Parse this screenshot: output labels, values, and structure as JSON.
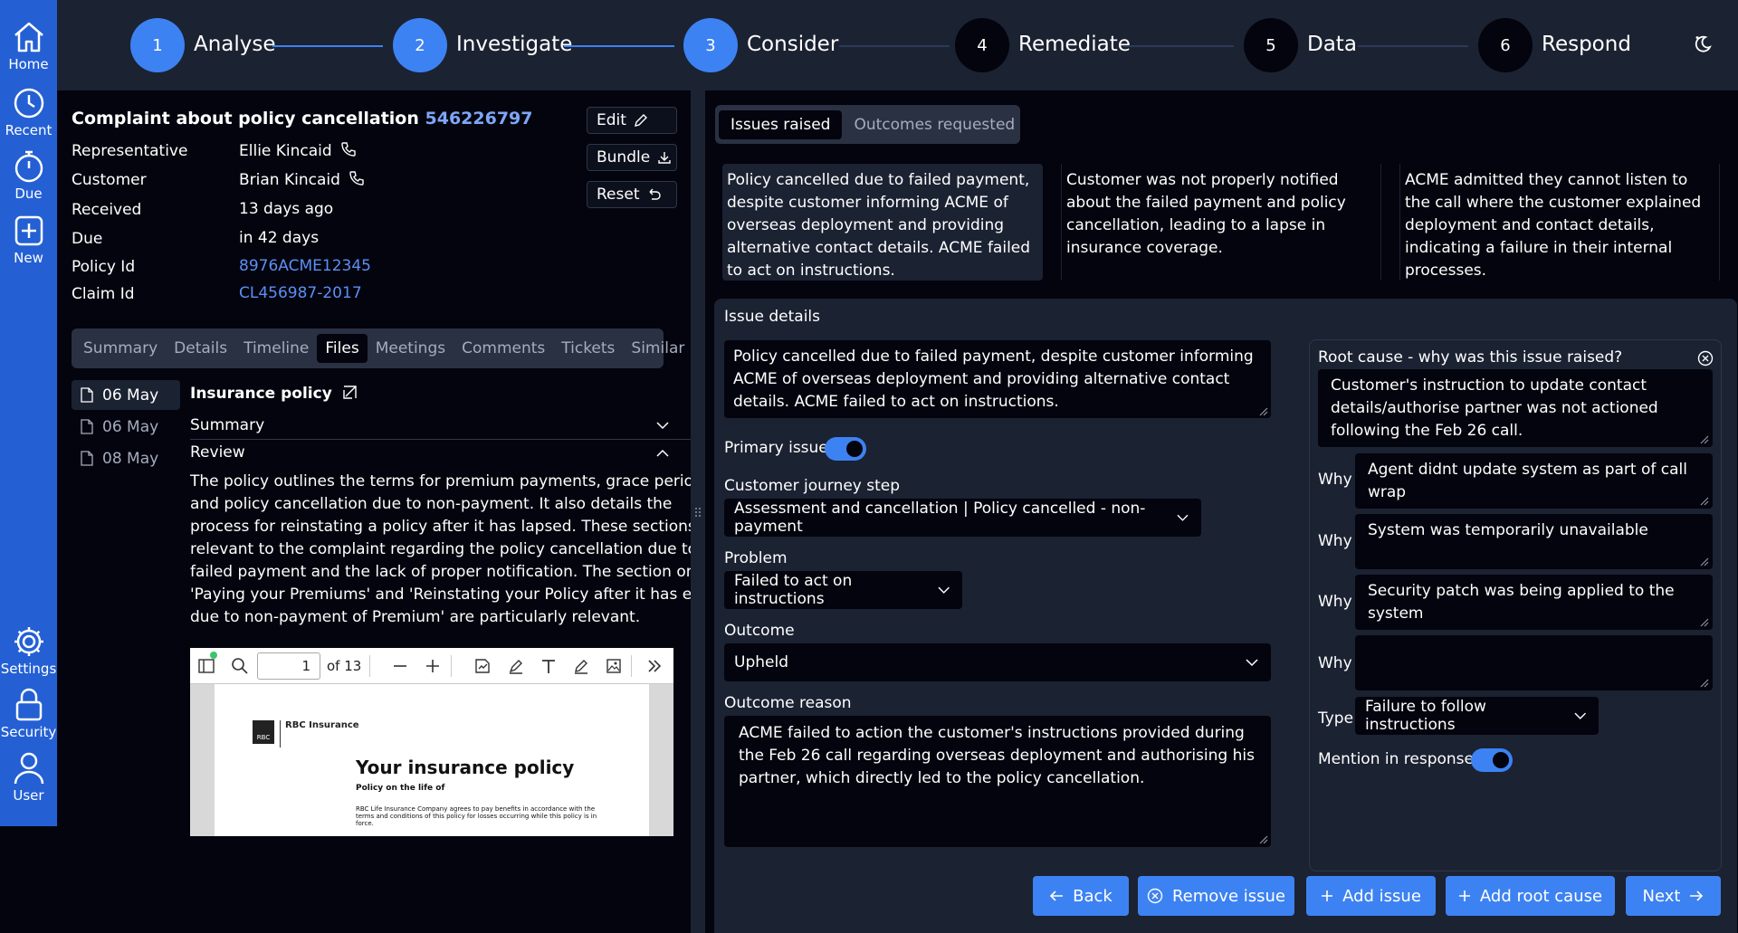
{
  "sidebar": {
    "items": [
      {
        "label": "Home",
        "icon": "home-icon"
      },
      {
        "label": "Recent",
        "icon": "clock-icon"
      },
      {
        "label": "Due",
        "icon": "stopwatch-icon"
      },
      {
        "label": "New",
        "icon": "plus-square-icon"
      },
      {
        "label": "Settings",
        "icon": "gear-icon"
      },
      {
        "label": "Security",
        "icon": "lock-icon"
      },
      {
        "label": "User",
        "icon": "user-icon"
      }
    ]
  },
  "stepper": {
    "steps": [
      {
        "number": "1",
        "label": "Analyse",
        "state": "active"
      },
      {
        "number": "2",
        "label": "Investigate",
        "state": "active"
      },
      {
        "number": "3",
        "label": "Consider",
        "state": "active"
      },
      {
        "number": "4",
        "label": "Remediate",
        "state": "inactive"
      },
      {
        "number": "5",
        "label": "Data",
        "state": "inactive"
      },
      {
        "number": "6",
        "label": "Respond",
        "state": "inactive"
      }
    ]
  },
  "complaint": {
    "title": "Complaint about policy cancellation",
    "id": "546226797",
    "fields": [
      {
        "label": "Representative",
        "value": "Ellie Kincaid"
      },
      {
        "label": "Customer",
        "value": "Brian Kincaid"
      },
      {
        "label": "Received",
        "value": "13 days ago"
      },
      {
        "label": "Due",
        "value": "in 42 days"
      },
      {
        "label": "Policy Id",
        "value": "8976ACME12345"
      },
      {
        "label": "Claim Id",
        "value": "CL456987-2017"
      }
    ],
    "actions": {
      "edit": "Edit",
      "bundle": "Bundle",
      "reset": "Reset"
    }
  },
  "left_tabs": [
    "Summary",
    "Details",
    "Timeline",
    "Files",
    "Meetings",
    "Comments",
    "Tickets",
    "Similar"
  ],
  "left_active_tab": "Files",
  "files": [
    {
      "date": "06 May"
    },
    {
      "date": "06 May"
    },
    {
      "date": "08 May"
    }
  ],
  "file_detail": {
    "title": "Insurance policy",
    "summary_label": "Summary",
    "review_label": "Review",
    "review_text": "The policy outlines the terms for premium payments, grace periods, and policy cancellation due to non-payment. It also details the process for reinstating a policy after it has lapsed. These sections are relevant to the complaint regarding the policy cancellation due to a failed payment and the lack of proper notification. The section on 'Paying your Premiums' and 'Reinstating your Policy after it has ended due to non-payment of Premium' are particularly relevant."
  },
  "pdf": {
    "page": "1",
    "of": "of 13",
    "brand": "RBC Insurance",
    "logo_text": "RBC",
    "heading": "Your insurance policy",
    "subheading": "Policy   on the life of",
    "body": "RBC Life Insurance Company agrees to pay benefits in accordance with the terms and conditions of this policy for losses occurring while this policy is in force."
  },
  "right_tabs": [
    "Issues raised",
    "Outcomes requested"
  ],
  "right_active_tab": "Issues raised",
  "issues": [
    "Policy cancelled due to failed payment, despite customer informing ACME of overseas deployment and providing alternative contact details. ACME failed to act on instructions.",
    "Customer was not properly notified about the failed payment and policy cancellation, leading to a lapse in insurance coverage.",
    "ACME admitted they cannot listen to the call where the customer explained deployment and contact details, indicating a failure in their internal processes."
  ],
  "issue_details": {
    "heading": "Issue details",
    "description": "Policy cancelled due to failed payment, despite customer informing ACME of overseas deployment and providing alternative contact details. ACME failed to act on instructions.",
    "primary_issue_label": "Primary issue",
    "primary_issue": true,
    "journey_label": "Customer journey step",
    "journey_value": "Assessment and cancellation | Policy cancelled - non-payment",
    "problem_label": "Problem",
    "problem_value": "Failed to act on instructions",
    "outcome_label": "Outcome",
    "outcome_value": "Upheld",
    "reason_label": "Outcome reason",
    "reason_value": "ACME failed to action the customer's instructions provided during the Feb 26 call regarding overseas deployment and authorising his partner, which directly led to the policy cancellation."
  },
  "root_cause": {
    "heading": "Root cause - why was this issue raised?",
    "value": "Customer's instruction to update contact details/authorise partner was not actioned following the Feb 26 call.",
    "why_label": "Why",
    "whys": [
      "Agent didnt update system as part of call wrap",
      "System was temporarily unavailable",
      "Security patch was being applied to the system",
      ""
    ],
    "type_label": "Type",
    "type_value": "Failure to follow instructions",
    "mention_label": "Mention in response",
    "mention": true
  },
  "footer_buttons": {
    "back": "Back",
    "remove": "Remove issue",
    "add_issue": "Add issue",
    "add_root": "Add root cause",
    "next": "Next"
  },
  "colors": {
    "accent": "#3d82f2",
    "sidebar": "#2460d4",
    "panel": "#1b2232",
    "background": "#04040e",
    "link": "#5c8ff5"
  }
}
